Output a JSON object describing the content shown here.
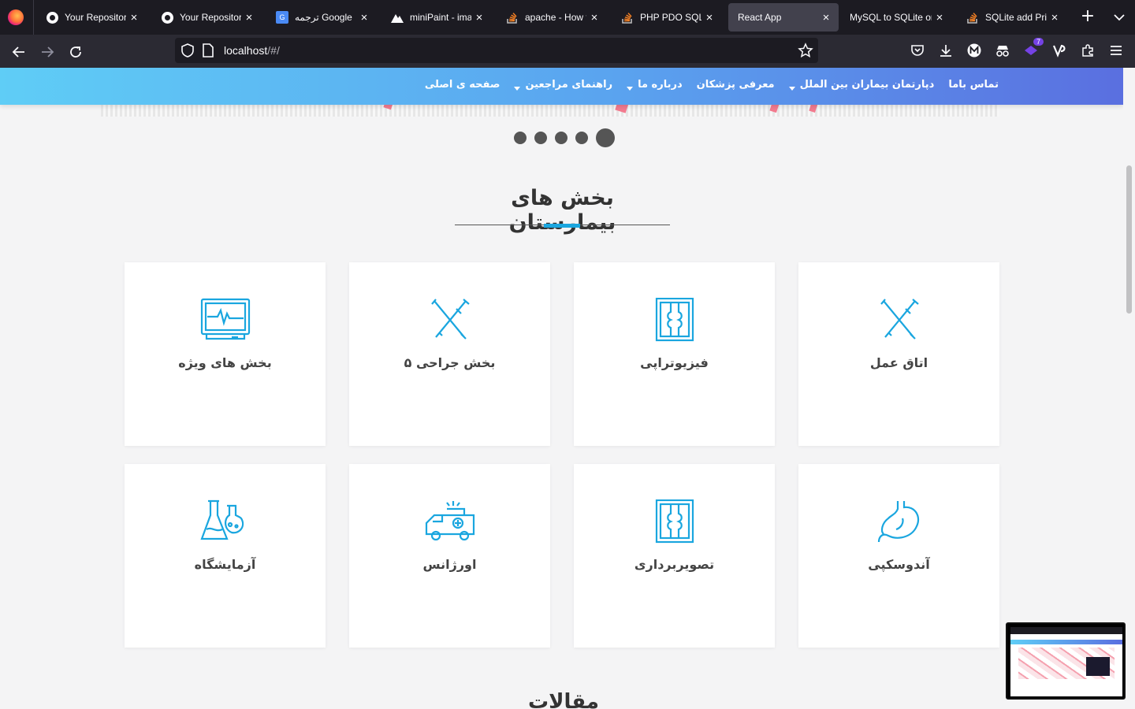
{
  "browser": {
    "tabs": [
      {
        "title": "Your Repositories",
        "favicon": "github-icon"
      },
      {
        "title": "Your Repositories",
        "favicon": "github-icon"
      },
      {
        "title": "ترجمه Google",
        "favicon": "google-translate-icon"
      },
      {
        "title": "miniPaint - image",
        "favicon": "minipaint-icon"
      },
      {
        "title": "apache - How to",
        "favicon": "stackoverflow-icon"
      },
      {
        "title": "PHP PDO SQLite",
        "favicon": "stackoverflow-icon"
      },
      {
        "title": "React App",
        "favicon": "none",
        "active": true
      },
      {
        "title": "MySQL to SQLite onli",
        "favicon": "none"
      },
      {
        "title": "SQLite add Prima",
        "favicon": "stackoverflow-icon"
      }
    ],
    "url_host": "localhost",
    "url_path": "/#/",
    "extension_badge": "7"
  },
  "site": {
    "menu": [
      {
        "label": "صفحه ی اصلی",
        "has_dropdown": false
      },
      {
        "label": "راهنمای مراجعین",
        "has_dropdown": true
      },
      {
        "label": "درباره ما",
        "has_dropdown": true
      },
      {
        "label": "معرفی پزشکان",
        "has_dropdown": false
      },
      {
        "label": "دپارتمان بیماران بین الملل",
        "has_dropdown": true
      },
      {
        "label": "تماس باما",
        "has_dropdown": false
      }
    ],
    "slider": {
      "dot_count": 5,
      "active_index": 4
    },
    "section_title": "بخش های بیمارستان",
    "departments": [
      {
        "label": "اتاق عمل",
        "icon": "scalpel-syringe-icon"
      },
      {
        "label": "فیزیوتراپی",
        "icon": "xray-knee-icon"
      },
      {
        "label": "بخش جراحی ۵",
        "icon": "scalpel-syringe-icon"
      },
      {
        "label": "بخش های ویژه",
        "icon": "heart-monitor-icon"
      },
      {
        "label": "آندوسکپی",
        "icon": "stomach-icon"
      },
      {
        "label": "تصویربرداری",
        "icon": "xray-knee-icon"
      },
      {
        "label": "اورژانس",
        "icon": "ambulance-icon"
      },
      {
        "label": "آزمایشگاه",
        "icon": "lab-flasks-icon"
      }
    ],
    "next_section_title": "مقالات"
  },
  "colors": {
    "accent": "#1aa6df",
    "nav_start": "#5fcdf6",
    "nav_end": "#5a6fe0"
  }
}
